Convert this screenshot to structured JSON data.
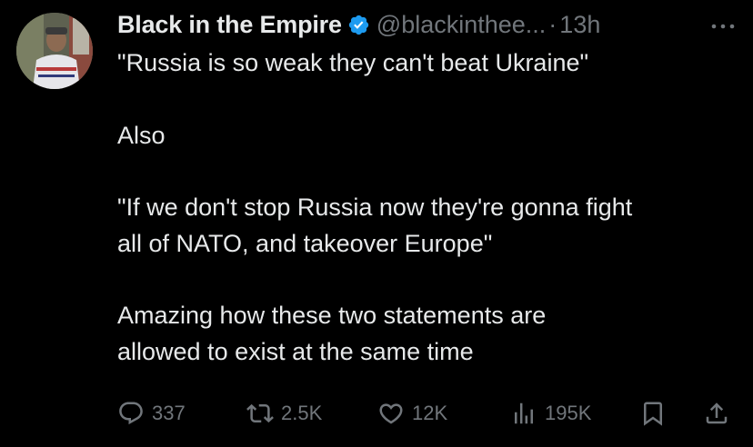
{
  "tweet": {
    "display_name": "Black in the Empire",
    "handle": "@blackinthee...",
    "separator": "·",
    "time": "13h",
    "paragraphs": [
      [
        "\"Russia is so weak they can't beat Ukraine\""
      ],
      [
        "Also"
      ],
      [
        "\"If we don't stop Russia now they're gonna fight",
        "all of NATO, and takeover Europe\""
      ],
      [
        "Amazing how these two statements are",
        "allowed to exist at the same time"
      ]
    ]
  },
  "actions": {
    "replies": "337",
    "reposts": "2.5K",
    "likes": "12K",
    "views": "195K"
  },
  "icons": {
    "verified": "verified-badge-icon",
    "more": "more-icon",
    "reply": "reply-icon",
    "repost": "repost-icon",
    "like": "heart-icon",
    "views": "views-icon",
    "bookmark": "bookmark-icon",
    "share": "share-icon"
  },
  "colors": {
    "background": "#000000",
    "text": "#e7e9ea",
    "secondary": "#71767b",
    "verified": "#1d9bf0"
  }
}
